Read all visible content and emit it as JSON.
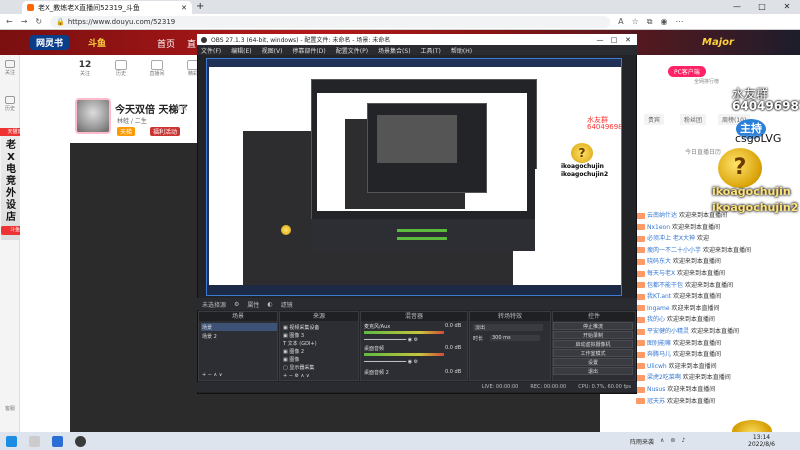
{
  "browser": {
    "tab_title": "老X_教练老X直播间52319_斗鱼",
    "url": "https://www.douyu.com/52319",
    "new_tab": "+"
  },
  "douyu": {
    "logo": "网灵书",
    "brand": "斗鱼",
    "nav_home": "首页",
    "nav_more": "直",
    "major": "Major",
    "stats": [
      {
        "n": "12",
        "label": "关注"
      },
      {
        "n": "",
        "label": "历史"
      },
      {
        "n": "",
        "label": "直播间"
      },
      {
        "n": "",
        "label": "精彩"
      },
      {
        "n": "",
        "label": "游戏"
      }
    ],
    "sidebar": [
      "关注",
      "历史"
    ],
    "banner_top": "天猫双十一",
    "banner_vertical": "老X电竞外设店",
    "fish_badge": "斗鱼购物",
    "subscribe": "客服",
    "stream_title": "今天双倍 天梯了",
    "stream_cat": "单机",
    "stream_user": "林蛙 / 二生",
    "rank_badge": "天梯",
    "welfare": "福利活动"
  },
  "right": {
    "pc_button": "PC客户端",
    "rank_list": "全网排行榜",
    "tabs": [
      "贵宾",
      "粉丝团",
      "周榜(10)"
    ],
    "chat_calendar": "今日直播日历",
    "overlay_name": "水友群",
    "overlay_qq": "640496987",
    "overlay_logo": "主持",
    "overlay_csgo": "csgoLVG",
    "coin_glyph": "?",
    "handle1": "ikoagochujin",
    "handle2": "ikoagochujin2",
    "chat": [
      {
        "u": "云南纳什达",
        "t": "欢迎来到本直播间"
      },
      {
        "u": "Nx1eon",
        "t": "欢迎来到本直播间"
      },
      {
        "u": "必须冲上 老X大神",
        "t": "欢迎"
      },
      {
        "u": "瘦肉一不二十小小芋",
        "t": "欢迎来到本直播间"
      },
      {
        "u": "晓码东大 ",
        "t": "欢迎来到本直播间"
      },
      {
        "u": "每天与老X",
        "t": "欢迎来到本直播间"
      },
      {
        "u": "包都不能干包",
        "t": "欢迎来到本直播间"
      },
      {
        "u": "我KT.ant",
        "t": "欢迎来到本直播间"
      },
      {
        "u": "Ingame",
        "t": "欢迎来到本直播间"
      },
      {
        "u": "我的心 ",
        "t": "欢迎来到本直播间"
      },
      {
        "u": "平安健的小精灵",
        "t": "欢迎来到本直播间"
      },
      {
        "u": "图别能嘛",
        "t": "欢迎来到本直播间"
      },
      {
        "u": "奔腾马儿",
        "t": "欢迎来到本直播间"
      },
      {
        "u": "Ulicwh",
        "t": "欢迎来到本直播间"
      },
      {
        "u": "梁虎2吃菜啊",
        "t": "欢迎来到本直播间"
      },
      {
        "u": "Nusus",
        "t": "欢迎来到本直播间"
      },
      {
        "u": "冠天苏",
        "t": "欢迎来到本直播间"
      }
    ]
  },
  "obs": {
    "title": "OBS 27.1.3 (64-bit, windows) - 配置文件: 未命名 - 场景: 未命名",
    "menu": [
      "文件(F)",
      "编辑(E)",
      "视图(V)",
      "停靠部件(D)",
      "配置文件(P)",
      "场景集合(S)",
      "工具(T)",
      "帮助(H)"
    ],
    "status_top": [
      "未选择源",
      "属性",
      "滤镜"
    ],
    "scenes": {
      "head": "场景",
      "items": [
        "场景",
        "场景 2"
      ]
    },
    "sources": {
      "head": "来源",
      "items": [
        "视频采集设备",
        "图像 3",
        "文本 (GDI+)",
        "图像 2",
        "图像",
        "显示器采集"
      ]
    },
    "mixer": {
      "head": "混音器",
      "items": [
        "麦克风/Aux",
        "桌面音频",
        "桌面音频 2"
      ],
      "db": [
        "0.0 dB",
        "0.0 dB",
        "0.0 dB"
      ]
    },
    "transitions": {
      "head": "转场特效",
      "fade": "淡出",
      "duration_label": "时长",
      "duration": "300 ms"
    },
    "controls": {
      "head": "控件",
      "buttons": [
        "停止推流",
        "开始录制",
        "启动虚拟摄像机",
        "工作室模式",
        "设置",
        "退出"
      ]
    },
    "statusbar": {
      "live": "LIVE: 00:00:00",
      "rec": "REC: 00:00:00",
      "cpu": "CPU: 0.7%, 60.00 fps"
    }
  },
  "taskbar": {
    "tray": "阵雨来袭",
    "time": "13:14",
    "date": "2022/8/6"
  },
  "colors": {
    "douyu_red": "#b5191a",
    "obs_dark": "#232428",
    "accent_blue": "#3d7bd1"
  }
}
